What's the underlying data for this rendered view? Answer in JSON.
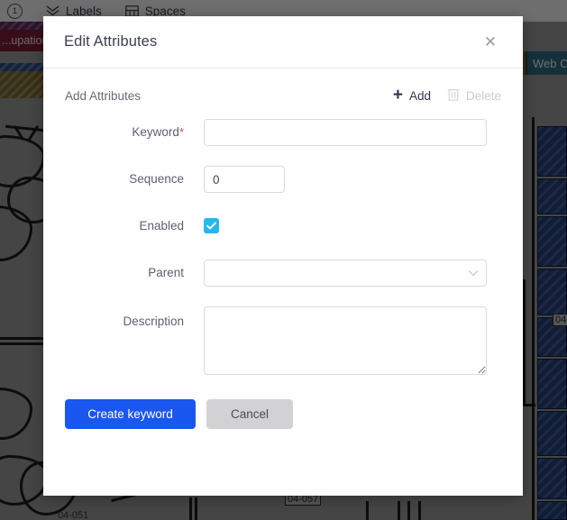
{
  "background": {
    "toolbar": {
      "badge": "1",
      "items": [
        {
          "label": "Labels",
          "icon": "layers-chevron-icon"
        },
        {
          "label": "Spaces",
          "icon": "grid-squares-icon"
        }
      ]
    },
    "labels": [
      {
        "text": "",
        "color": "#5d2a63"
      },
      {
        "text": "...upation...",
        "color": "#7a1d35"
      },
      {
        "text": "",
        "color": "#2f4a8c"
      },
      {
        "text": "",
        "color": "#7a6a34"
      }
    ],
    "chips": [
      {
        "text": "Web C...",
        "color": "#2f6c82"
      }
    ],
    "drawing_tags": [
      "04-051",
      "04-057",
      "04-..."
    ]
  },
  "modal": {
    "title": "Edit Attributes",
    "close_label": "✕",
    "attributes_section": {
      "title": "Add Attributes",
      "add_label": "Add",
      "add_icon": "plus-icon",
      "delete_label": "Delete",
      "delete_icon": "trash-icon",
      "delete_disabled": true
    },
    "form": {
      "keyword": {
        "label": "Keyword",
        "required_marker": "*",
        "value": "",
        "placeholder": ""
      },
      "sequence": {
        "label": "Sequence",
        "value": "0",
        "placeholder": ""
      },
      "enabled": {
        "label": "Enabled",
        "checked": true,
        "check_glyph": "✓"
      },
      "parent": {
        "label": "Parent",
        "value": "",
        "placeholder": "",
        "chevron_icon": "chevron-down-icon"
      },
      "description": {
        "label": "Description",
        "value": "",
        "placeholder": ""
      }
    },
    "buttons": {
      "submit_label": "Create keyword",
      "cancel_label": "Cancel"
    }
  },
  "colors": {
    "primary": "#1a56f0",
    "checkbox": "#29b6ec",
    "required": "#f2464b",
    "secondary_button": "#d2d2d4"
  }
}
